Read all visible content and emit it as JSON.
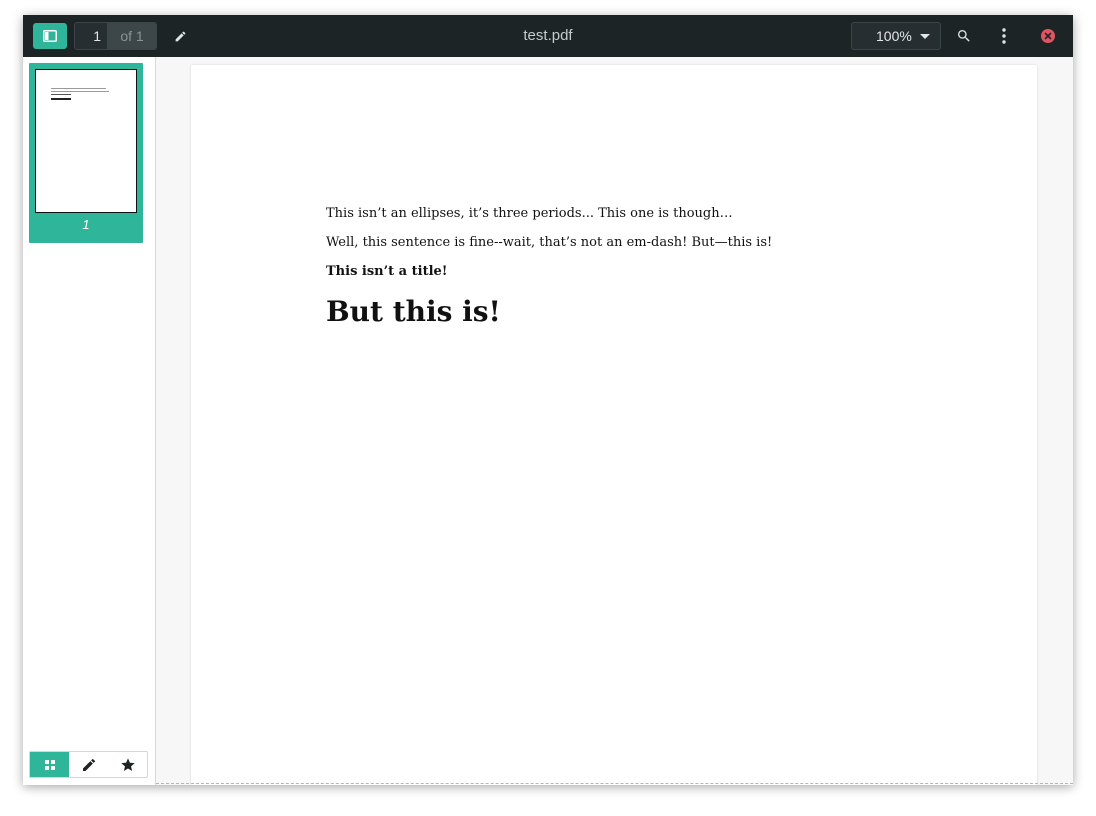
{
  "toolbar": {
    "page_current": "1",
    "page_of": "of 1",
    "title": "test.pdf",
    "zoom": "100%"
  },
  "sidebar": {
    "thumbnails": [
      {
        "label": "1"
      }
    ],
    "tabs": [
      {
        "icon": "grid-icon"
      },
      {
        "icon": "pencil-icon"
      },
      {
        "icon": "star-icon"
      }
    ]
  },
  "document": {
    "lines": [
      "This isn’t an ellipses, it’s three periods... This one is though…",
      "Well, this sentence is fine--wait, that’s not an em-dash! But—this is!",
      "This isn’t a title!",
      "But this is!"
    ]
  },
  "colors": {
    "accent": "#2fb59a",
    "toolbar": "#1d2426",
    "close": "#e05561"
  }
}
